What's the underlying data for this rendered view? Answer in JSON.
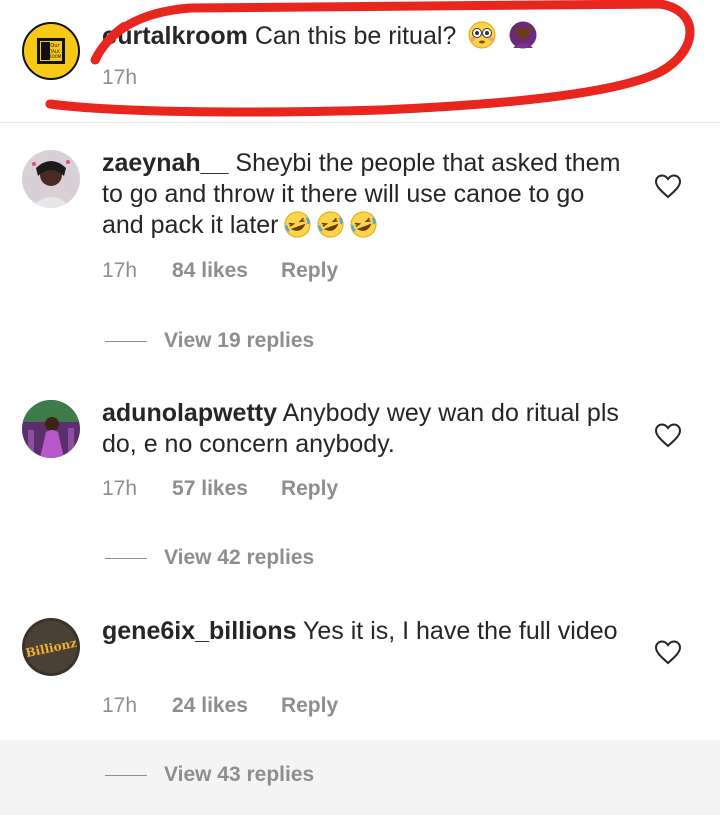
{
  "caption": {
    "username": "ourtalkroom",
    "text": "Can this be ritual?",
    "time": "17h",
    "avatar_text": [
      "Our",
      "TALK",
      "ROOM"
    ],
    "emojis": [
      "flushed-face-emoji",
      "person-gesturing-no-emoji"
    ]
  },
  "comments": [
    {
      "username": "zaeynah__",
      "text": "Sheybi the people that asked them to go and throw it there will use canoe to go and pack it later",
      "emojis": [
        "rolling-laughing-emoji",
        "rolling-laughing-emoji",
        "rolling-laughing-emoji"
      ],
      "time": "17h",
      "likes": "84 likes",
      "reply_label": "Reply",
      "view_replies": "View 19 replies"
    },
    {
      "username": "adunolapwetty",
      "text": "Anybody wey wan do ritual pls do, e no concern anybody.",
      "time": "17h",
      "likes": "57 likes",
      "reply_label": "Reply",
      "view_replies": "View 42 replies"
    },
    {
      "username": "gene6ix_billions",
      "text": "Yes it is, I have the full video",
      "time": "17h",
      "likes": "24 likes",
      "reply_label": "Reply",
      "view_replies": "View 43 replies",
      "avatar_text": "Billionz"
    }
  ],
  "colors": {
    "annotation_red": "#e8261d",
    "text": "#262626",
    "muted": "#8e8e8e",
    "logo_yellow": "#f7c917"
  }
}
